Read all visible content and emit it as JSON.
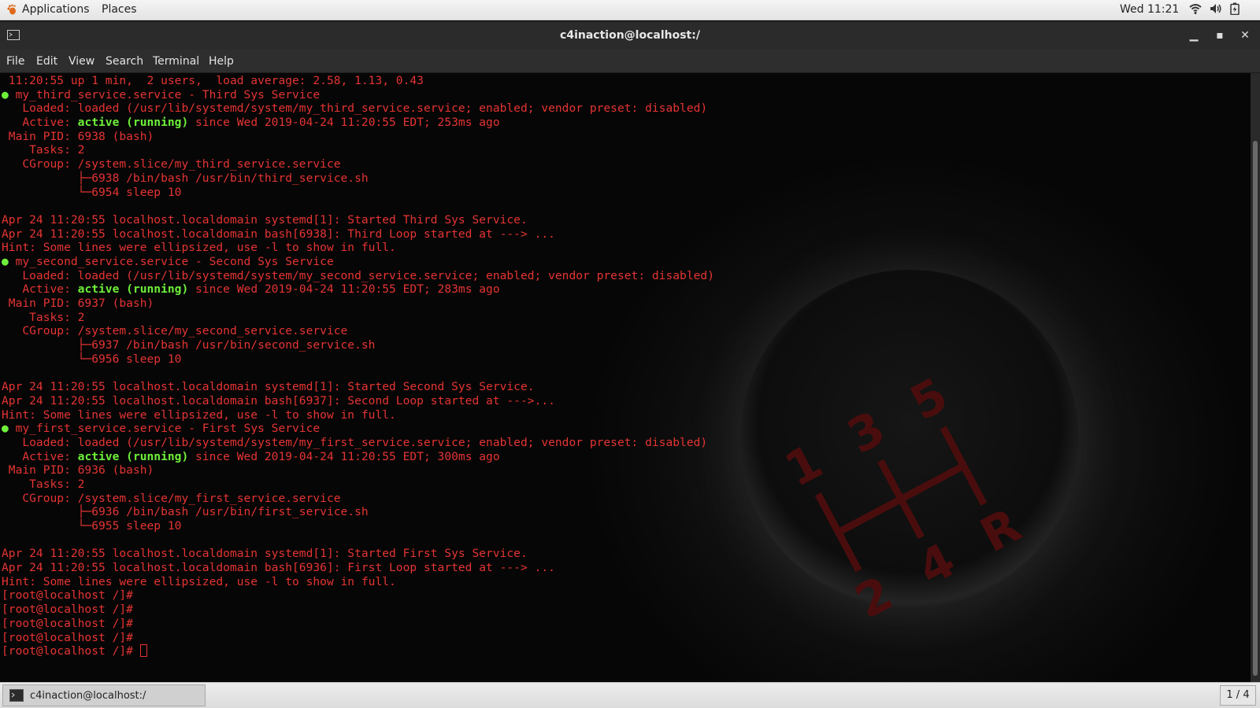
{
  "top_panel": {
    "applications_label": "Applications",
    "places_label": "Places",
    "clock": "Wed 11:21"
  },
  "window": {
    "title": "c4inaction@localhost:/",
    "minimize_glyph": "▁",
    "maximize_glyph": "▪",
    "close_glyph": "✕"
  },
  "menu": [
    "File",
    "Edit",
    "View",
    "Search",
    "Terminal",
    "Help"
  ],
  "terminal": {
    "lines": [
      {
        "segments": [
          {
            "text": " 11:20:55 up 1 min,  2 users,  load average: 2.58, 1.13, 0.43"
          }
        ]
      },
      {
        "segments": [
          {
            "text": "●",
            "style": "dot"
          },
          {
            "text": " my_third_service.service - Third Sys Service"
          }
        ]
      },
      {
        "segments": [
          {
            "text": "   Loaded: loaded (/usr/lib/systemd/system/my_third_service.service; enabled; vendor preset: disabled)"
          }
        ]
      },
      {
        "segments": [
          {
            "text": "   Active: "
          },
          {
            "text": "active (running)",
            "style": "g"
          },
          {
            "text": " since Wed 2019-04-24 11:20:55 EDT; 253ms ago"
          }
        ]
      },
      {
        "segments": [
          {
            "text": " Main PID: 6938 (bash)"
          }
        ]
      },
      {
        "segments": [
          {
            "text": "    Tasks: 2"
          }
        ]
      },
      {
        "segments": [
          {
            "text": "   CGroup: /system.slice/my_third_service.service"
          }
        ]
      },
      {
        "segments": [
          {
            "text": "           ├─6938 /bin/bash /usr/bin/third_service.sh"
          }
        ]
      },
      {
        "segments": [
          {
            "text": "           └─6954 sleep 10"
          }
        ]
      },
      {
        "segments": [
          {
            "text": ""
          }
        ]
      },
      {
        "segments": [
          {
            "text": "Apr 24 11:20:55 localhost.localdomain systemd[1]: Started Third Sys Service."
          }
        ]
      },
      {
        "segments": [
          {
            "text": "Apr 24 11:20:55 localhost.localdomain bash[6938]: Third Loop started at ---> ..."
          }
        ]
      },
      {
        "segments": [
          {
            "text": "Hint: Some lines were ellipsized, use -l to show in full."
          }
        ]
      },
      {
        "segments": [
          {
            "text": "●",
            "style": "dot"
          },
          {
            "text": " my_second_service.service - Second Sys Service"
          }
        ]
      },
      {
        "segments": [
          {
            "text": "   Loaded: loaded (/usr/lib/systemd/system/my_second_service.service; enabled; vendor preset: disabled)"
          }
        ]
      },
      {
        "segments": [
          {
            "text": "   Active: "
          },
          {
            "text": "active (running)",
            "style": "g"
          },
          {
            "text": " since Wed 2019-04-24 11:20:55 EDT; 283ms ago"
          }
        ]
      },
      {
        "segments": [
          {
            "text": " Main PID: 6937 (bash)"
          }
        ]
      },
      {
        "segments": [
          {
            "text": "    Tasks: 2"
          }
        ]
      },
      {
        "segments": [
          {
            "text": "   CGroup: /system.slice/my_second_service.service"
          }
        ]
      },
      {
        "segments": [
          {
            "text": "           ├─6937 /bin/bash /usr/bin/second_service.sh"
          }
        ]
      },
      {
        "segments": [
          {
            "text": "           └─6956 sleep 10"
          }
        ]
      },
      {
        "segments": [
          {
            "text": ""
          }
        ]
      },
      {
        "segments": [
          {
            "text": "Apr 24 11:20:55 localhost.localdomain systemd[1]: Started Second Sys Service."
          }
        ]
      },
      {
        "segments": [
          {
            "text": "Apr 24 11:20:55 localhost.localdomain bash[6937]: Second Loop started at --->..."
          }
        ]
      },
      {
        "segments": [
          {
            "text": "Hint: Some lines were ellipsized, use -l to show in full."
          }
        ]
      },
      {
        "segments": [
          {
            "text": "●",
            "style": "dot"
          },
          {
            "text": " my_first_service.service - First Sys Service"
          }
        ]
      },
      {
        "segments": [
          {
            "text": "   Loaded: loaded (/usr/lib/systemd/system/my_first_service.service; enabled; vendor preset: disabled)"
          }
        ]
      },
      {
        "segments": [
          {
            "text": "   Active: "
          },
          {
            "text": "active (running)",
            "style": "g"
          },
          {
            "text": " since Wed 2019-04-24 11:20:55 EDT; 300ms ago"
          }
        ]
      },
      {
        "segments": [
          {
            "text": " Main PID: 6936 (bash)"
          }
        ]
      },
      {
        "segments": [
          {
            "text": "    Tasks: 2"
          }
        ]
      },
      {
        "segments": [
          {
            "text": "   CGroup: /system.slice/my_first_service.service"
          }
        ]
      },
      {
        "segments": [
          {
            "text": "           ├─6936 /bin/bash /usr/bin/first_service.sh"
          }
        ]
      },
      {
        "segments": [
          {
            "text": "           └─6955 sleep 10"
          }
        ]
      },
      {
        "segments": [
          {
            "text": ""
          }
        ]
      },
      {
        "segments": [
          {
            "text": "Apr 24 11:20:55 localhost.localdomain systemd[1]: Started First Sys Service."
          }
        ]
      },
      {
        "segments": [
          {
            "text": "Apr 24 11:20:55 localhost.localdomain bash[6936]: First Loop started at ---> ..."
          }
        ]
      },
      {
        "segments": [
          {
            "text": "Hint: Some lines were ellipsized, use -l to show in full."
          }
        ]
      },
      {
        "segments": [
          {
            "text": "[root@localhost /]#"
          }
        ]
      },
      {
        "segments": [
          {
            "text": "[root@localhost /]#"
          }
        ]
      },
      {
        "segments": [
          {
            "text": "[root@localhost /]#"
          }
        ]
      },
      {
        "segments": [
          {
            "text": "[root@localhost /]#"
          }
        ]
      },
      {
        "segments": [
          {
            "text": "[root@localhost /]# "
          }
        ],
        "cursor": true
      }
    ]
  },
  "wallpaper": {
    "gear_numbers": [
      "1",
      "3",
      "5",
      "2",
      "4",
      "R"
    ]
  },
  "taskbar": {
    "task_label": "c4inaction@localhost:/",
    "workspace": "1 / 4"
  },
  "colors": {
    "terminal_text": "#e53433",
    "active_green": "#6ef03a",
    "titlebar": "#2b2b2b"
  },
  "icons": [
    "gnome-foot-icon",
    "wifi-icon",
    "volume-icon",
    "battery-icon",
    "terminal-icon"
  ]
}
